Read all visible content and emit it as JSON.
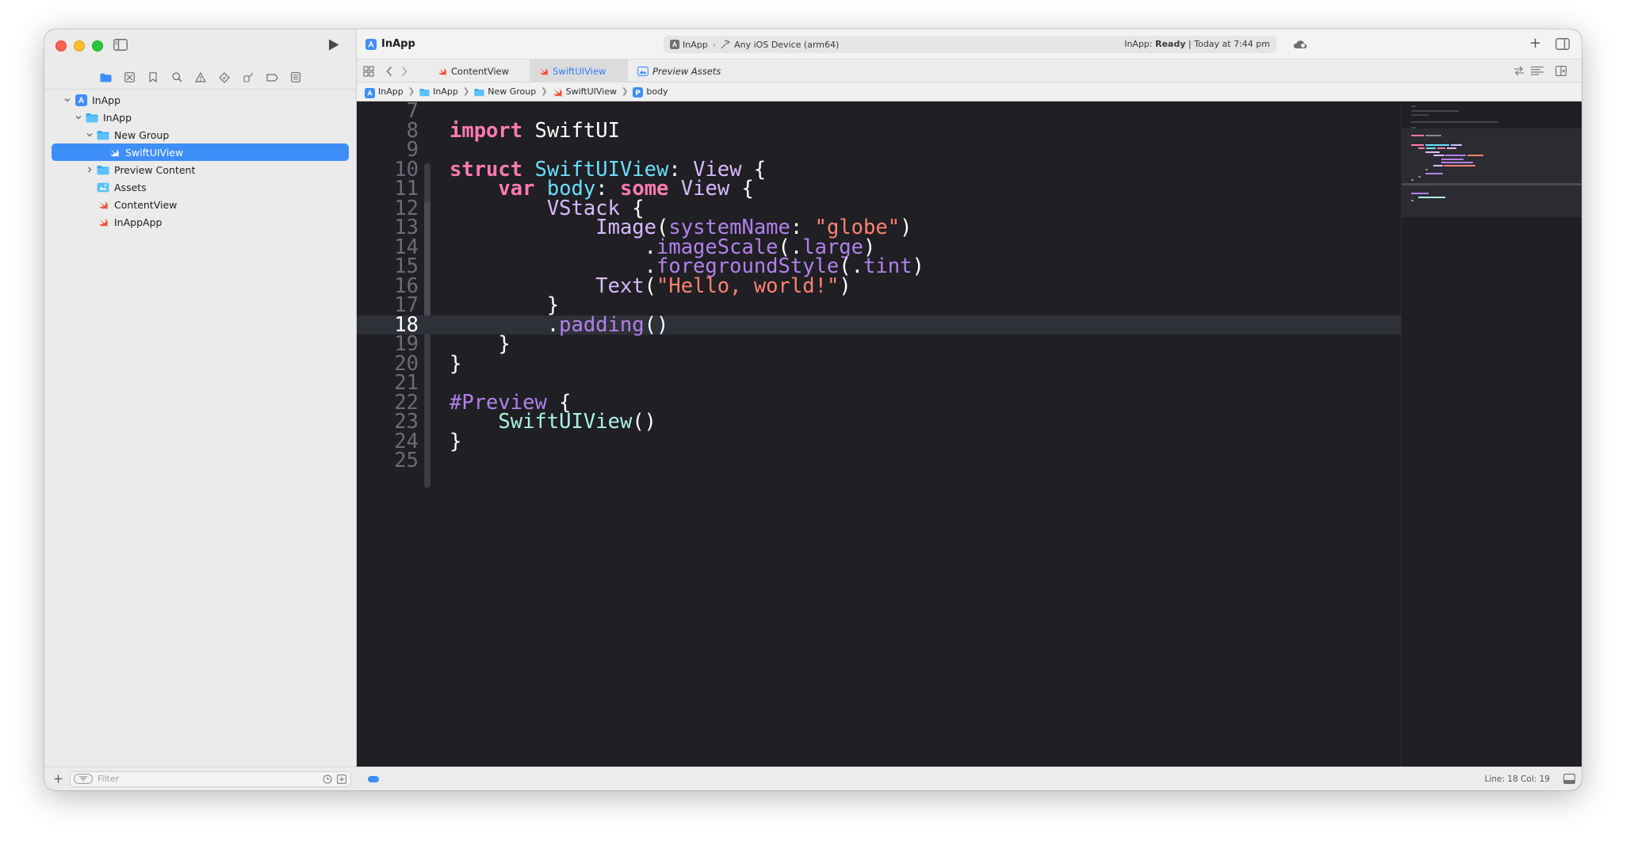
{
  "sidebar": {
    "tree": [
      {
        "label": "InApp",
        "icon": "project-icon",
        "indent": 0,
        "expanded": true
      },
      {
        "label": "InApp",
        "icon": "folder-icon",
        "indent": 1,
        "expanded": true
      },
      {
        "label": "New Group",
        "icon": "folder-icon",
        "indent": 2,
        "expanded": true
      },
      {
        "label": "SwiftUIView",
        "icon": "swift-file-icon",
        "indent": 3,
        "selected": true
      },
      {
        "label": "Preview Content",
        "icon": "folder-icon",
        "indent": 2,
        "expanded": false
      },
      {
        "label": "Assets",
        "icon": "asset-catalog-icon",
        "indent": 2
      },
      {
        "label": "ContentView",
        "icon": "swift-file-icon",
        "indent": 2
      },
      {
        "label": "InAppApp",
        "icon": "swift-file-icon",
        "indent": 2
      }
    ],
    "filter_placeholder": "Filter"
  },
  "toolbar": {
    "title": "InApp",
    "scheme": "InApp",
    "device": "Any iOS Device (arm64)",
    "status_prefix": "InApp:",
    "status_state": "Ready",
    "status_time": "Today at 7:44 pm"
  },
  "tabs": [
    {
      "label": "ContentView",
      "active": false
    },
    {
      "label": "SwiftUIView",
      "active": true
    },
    {
      "label": "Preview Assets",
      "active": false
    }
  ],
  "breadcrumbs": [
    "InApp",
    "InApp",
    "New Group",
    "SwiftUIView",
    "body"
  ],
  "editor": {
    "current_line": 18,
    "lines": [
      {
        "n": "7",
        "tokens": []
      },
      {
        "n": "8",
        "tokens": [
          [
            "kw",
            "import"
          ],
          [
            "pl",
            " SwiftUI"
          ]
        ]
      },
      {
        "n": "9",
        "tokens": []
      },
      {
        "n": "10",
        "tokens": [
          [
            "kw",
            "struct"
          ],
          [
            "pl",
            " "
          ],
          [
            "decl",
            "SwiftUIView"
          ],
          [
            "pl",
            ": "
          ],
          [
            "ty",
            "View"
          ],
          [
            "pl",
            " {"
          ]
        ]
      },
      {
        "n": "11",
        "tokens": [
          [
            "pl",
            "    "
          ],
          [
            "kw",
            "var"
          ],
          [
            "pl",
            " "
          ],
          [
            "decl",
            "body"
          ],
          [
            "pl",
            ": "
          ],
          [
            "kw",
            "some"
          ],
          [
            "pl",
            " "
          ],
          [
            "ty",
            "View"
          ],
          [
            "pl",
            " {"
          ]
        ]
      },
      {
        "n": "12",
        "tokens": [
          [
            "pl",
            "        "
          ],
          [
            "ty",
            "VStack"
          ],
          [
            "pl",
            " {"
          ]
        ]
      },
      {
        "n": "13",
        "tokens": [
          [
            "pl",
            "            "
          ],
          [
            "ty",
            "Image"
          ],
          [
            "pl",
            "("
          ],
          [
            "fn",
            "systemName"
          ],
          [
            "pl",
            ": "
          ],
          [
            "str",
            "\"globe\""
          ],
          [
            "pl",
            ")"
          ]
        ]
      },
      {
        "n": "14",
        "tokens": [
          [
            "pl",
            "                ."
          ],
          [
            "fn",
            "imageScale"
          ],
          [
            "pl",
            "(."
          ],
          [
            "fn",
            "large"
          ],
          [
            "pl",
            ")"
          ]
        ]
      },
      {
        "n": "15",
        "tokens": [
          [
            "pl",
            "                ."
          ],
          [
            "fn",
            "foregroundStyle"
          ],
          [
            "pl",
            "(."
          ],
          [
            "fn",
            "tint"
          ],
          [
            "pl",
            ")"
          ]
        ]
      },
      {
        "n": "16",
        "tokens": [
          [
            "pl",
            "            "
          ],
          [
            "ty",
            "Text"
          ],
          [
            "pl",
            "("
          ],
          [
            "str",
            "\"Hello, world!\""
          ],
          [
            "pl",
            ")"
          ]
        ]
      },
      {
        "n": "17",
        "tokens": [
          [
            "pl",
            "        }"
          ]
        ]
      },
      {
        "n": "18",
        "tokens": [
          [
            "pl",
            "        ."
          ],
          [
            "fn",
            "padding"
          ],
          [
            "pl",
            "()"
          ]
        ]
      },
      {
        "n": "19",
        "tokens": [
          [
            "pl",
            "    }"
          ]
        ]
      },
      {
        "n": "20",
        "tokens": [
          [
            "pl",
            "}"
          ]
        ]
      },
      {
        "n": "21",
        "tokens": []
      },
      {
        "n": "22",
        "tokens": [
          [
            "fn",
            "#Preview"
          ],
          [
            "pl",
            " {"
          ]
        ]
      },
      {
        "n": "23",
        "tokens": [
          [
            "pl",
            "    "
          ],
          [
            "cls",
            "SwiftUIView"
          ],
          [
            "pl",
            "()"
          ]
        ]
      },
      {
        "n": "24",
        "tokens": [
          [
            "pl",
            "}"
          ]
        ]
      },
      {
        "n": "25",
        "tokens": []
      }
    ]
  },
  "statusbar": {
    "line_col": "Line: 18  Col: 19"
  },
  "colors": {
    "accent": "#3e8ef7",
    "editor_bg": "#1f1f24",
    "keyword": "#ff7ab2",
    "type": "#dabaff",
    "declaration": "#6bdfff",
    "function": "#b281eb",
    "string": "#ff8170"
  }
}
